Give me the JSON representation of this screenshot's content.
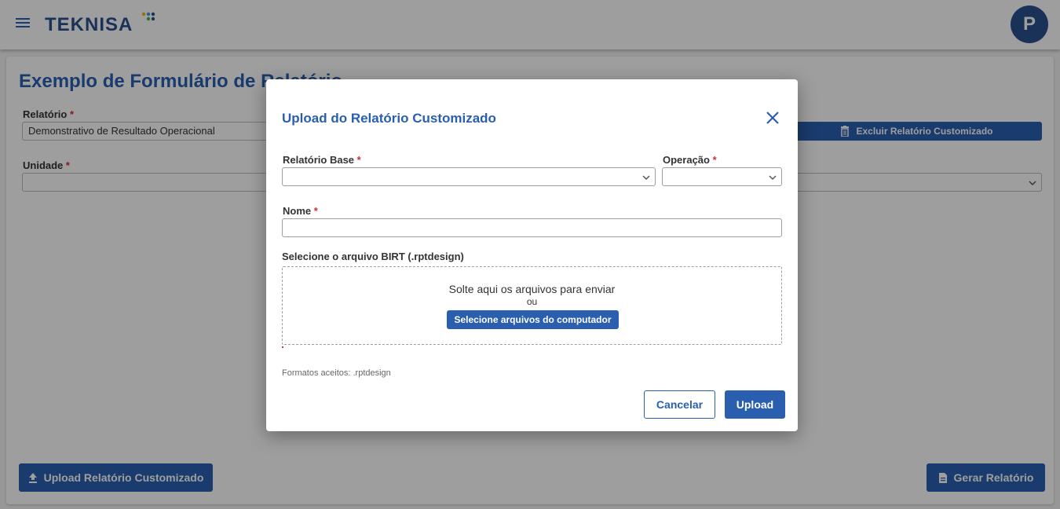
{
  "header": {
    "logo_text": "TEKNISA",
    "avatar_initial": "P",
    "brand_color": "#2a5fb0"
  },
  "page": {
    "title": "Exemplo de Formulário de Relatório",
    "relatorio_label": "Relatório",
    "relatorio_value": "Demonstrativo de Resultado Operacional",
    "unidade_label": "Unidade",
    "unidade_value": "",
    "excluir_button": "Excluir Relatório Customizado",
    "upload_button": "Upload Relatório Customizado",
    "gerar_button": "Gerar Relatório",
    "required_mark": "*"
  },
  "modal": {
    "title": "Upload do Relatório Customizado",
    "relatorio_base_label": "Relatório Base",
    "relatorio_base_value": "",
    "operacao_label": "Operação",
    "operacao_value": "",
    "nome_label": "Nome",
    "nome_value": "",
    "file_label": "Selecione o arquivo BIRT (.rptdesign)",
    "dropzone_text": "Solte aqui os arquivos para enviar",
    "dropzone_or": "ou",
    "select_files_button": "Selecione arquivos do computador",
    "formats_text": "Formatos aceitos: .rptdesign",
    "cancel_button": "Cancelar",
    "upload_button": "Upload"
  }
}
